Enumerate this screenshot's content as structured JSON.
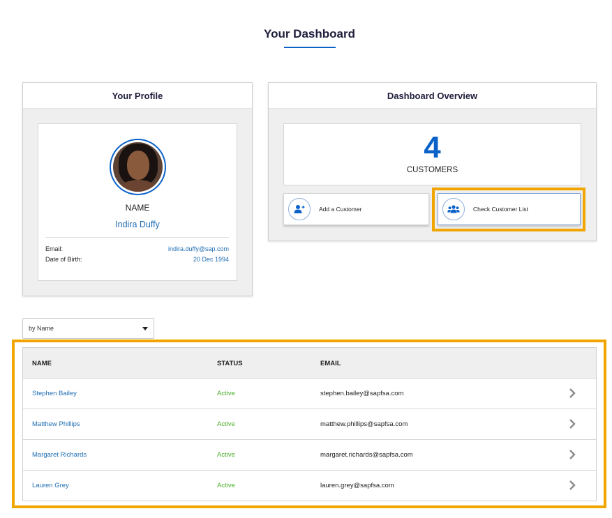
{
  "page": {
    "title": "Your Dashboard"
  },
  "profile": {
    "header": "Your Profile",
    "name_label": "NAME",
    "name": "Indira Duffy",
    "email_label": "Email:",
    "email": "indira.duffy@sap.com",
    "dob_label": "Date of Birth:",
    "dob": "20 Dec 1994"
  },
  "overview": {
    "header": "Dashboard Overview",
    "customer_count": "4",
    "customer_caption": "CUSTOMERS",
    "add_customer_label": "Add a Customer",
    "check_list_label": "Check Customer List"
  },
  "sort": {
    "selected": "by Name"
  },
  "table": {
    "headers": {
      "name": "NAME",
      "status": "STATUS",
      "email": "EMAIL"
    },
    "rows": [
      {
        "name": "Stephen Bailey",
        "status": "Active",
        "email": "stephen.bailey@sapfsa.com"
      },
      {
        "name": "Matthew Phillips",
        "status": "Active",
        "email": "matthew.phillips@sapfsa.com"
      },
      {
        "name": "Margaret Richards",
        "status": "Active",
        "email": "margaret.richards@sapfsa.com"
      },
      {
        "name": "Lauren Grey",
        "status": "Active",
        "email": "lauren.grey@sapfsa.com"
      }
    ]
  },
  "colors": {
    "accent": "#0a62c9",
    "link": "#1f6db3",
    "active": "#4caf2c",
    "highlight": "#f0a500"
  }
}
